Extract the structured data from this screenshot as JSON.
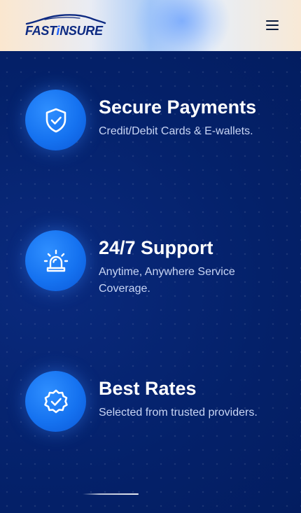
{
  "header": {
    "logo": {
      "part1": "FAST",
      "part2": "i",
      "part3": "NSURE"
    },
    "menu_icon": "hamburger-menu-icon"
  },
  "features": [
    {
      "icon": "shield-check-icon",
      "title": "Secure Payments",
      "description": "Credit/Debit Cards & E-wallets."
    },
    {
      "icon": "alarm-siren-icon",
      "title": "24/7 Support",
      "description": "Anytime, Anywhere Service Coverage."
    },
    {
      "icon": "badge-check-icon",
      "title": "Best Rates",
      "description": "Selected from trusted providers."
    }
  ],
  "colors": {
    "background": "#04216a",
    "icon_circle": "#1572f0",
    "title": "#ffffff",
    "description": "#c9d6f5",
    "logo": "#0d2a82",
    "logo_accent": "#1f63ff"
  }
}
